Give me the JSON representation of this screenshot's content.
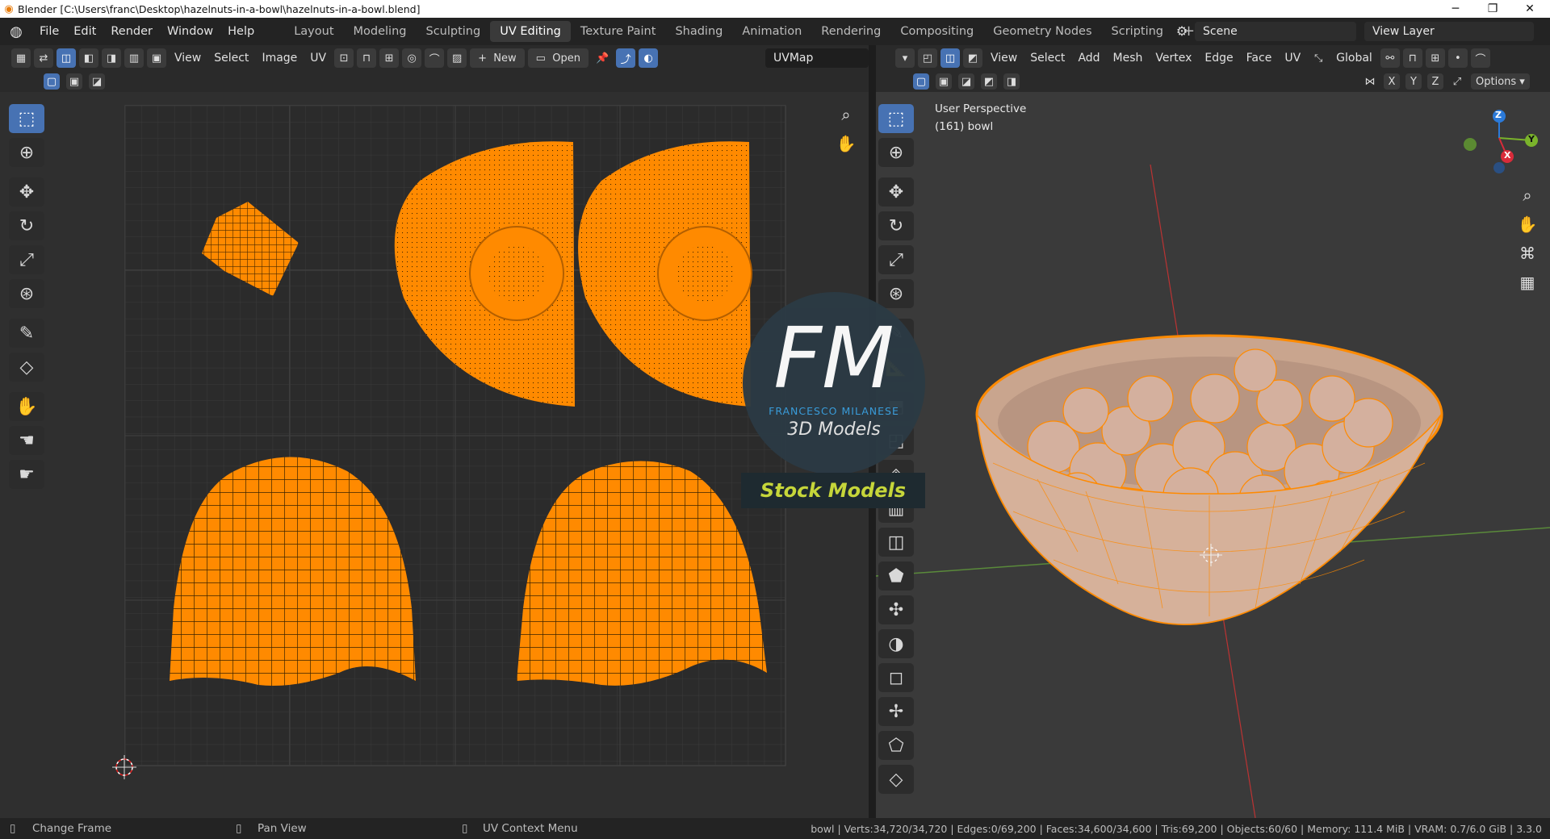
{
  "window": {
    "title": "Blender [C:\\Users\\franc\\Desktop\\hazelnuts-in-a-bowl\\hazelnuts-in-a-bowl.blend]",
    "minimize_glyph": "─",
    "maximize_glyph": "❐",
    "close_glyph": "✕"
  },
  "topbar": {
    "menus": [
      "File",
      "Edit",
      "Render",
      "Window",
      "Help"
    ],
    "workspaces": [
      "Layout",
      "Modeling",
      "Sculpting",
      "UV Editing",
      "Texture Paint",
      "Shading",
      "Animation",
      "Rendering",
      "Compositing",
      "Geometry Nodes",
      "Scripting"
    ],
    "active_workspace": "UV Editing",
    "add_workspace": "+",
    "scene": "Scene",
    "view_layer": "View Layer"
  },
  "uv_editor": {
    "menus": [
      "View",
      "Select",
      "Image",
      "UV"
    ],
    "new_label": "New",
    "open_label": "Open",
    "uvmap_label": "UVMap"
  },
  "viewport": {
    "menus": [
      "View",
      "Select",
      "Add",
      "Mesh",
      "Vertex",
      "Edge",
      "Face",
      "UV"
    ],
    "orientation": "Global",
    "axes": [
      "X",
      "Y",
      "Z"
    ],
    "options_label": "Options",
    "overlay_line1": "User Perspective",
    "overlay_line2": "(161) bowl",
    "gizmo": {
      "x": "X",
      "y": "Y",
      "z": "Z"
    }
  },
  "watermark": {
    "letters": "FM",
    "name": "FRANCESCO MILANESE",
    "line": "3D Models",
    "banner": "Stock Models"
  },
  "statusbar": {
    "left1": "Change Frame",
    "left2": "Pan View",
    "left3": "UV Context Menu",
    "stats": "bowl | Verts:34,720/34,720 | Edges:0/69,200 | Faces:34,600/34,600 | Tris:69,200 | Objects:60/60 | Memory: 111.4 MiB | VRAM: 0.7/6.0 GiB | 3.3.0"
  },
  "colors": {
    "accent": "#4772b3",
    "selection_orange": "#ff8a00",
    "header": "#2a2a2a",
    "background": "#1d1d1d"
  }
}
